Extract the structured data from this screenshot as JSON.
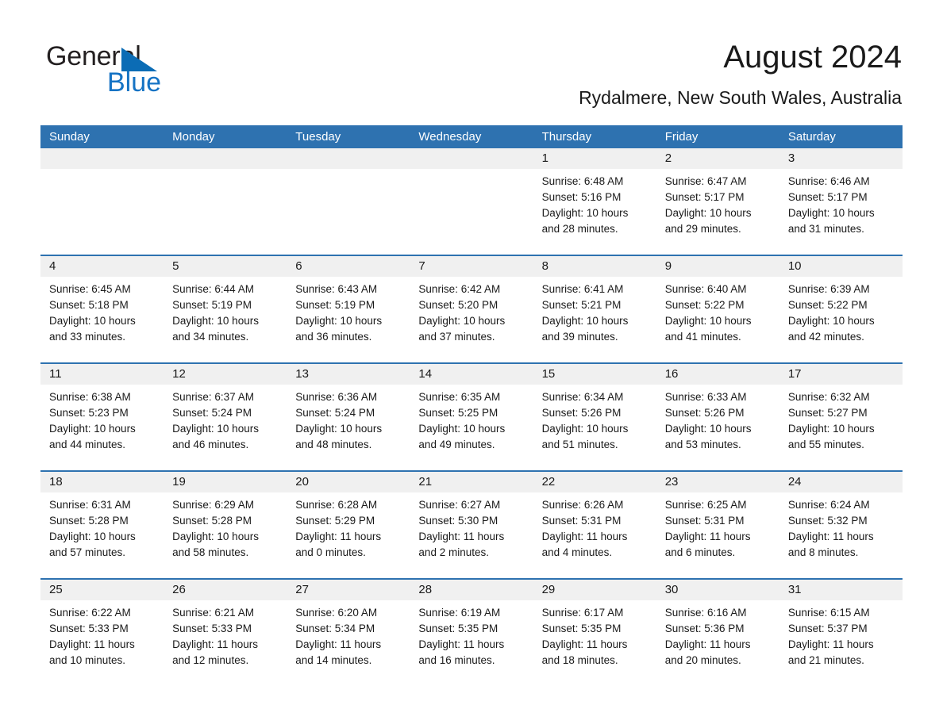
{
  "logo": {
    "word_one": "General",
    "word_two": "Blue",
    "triangle_color": "#0b6cb5",
    "blue_text_color": "#1573c4"
  },
  "header": {
    "title": "August 2024",
    "location": "Rydalmere, New South Wales, Australia"
  },
  "theme": {
    "header_blue": "#2e72b0",
    "date_band_gray": "#f0f0f0",
    "text_color": "#1a1a1a"
  },
  "calendar": {
    "weekday_headers": [
      "Sunday",
      "Monday",
      "Tuesday",
      "Wednesday",
      "Thursday",
      "Friday",
      "Saturday"
    ],
    "weeks": [
      {
        "days": [
          {
            "date": "",
            "lines": []
          },
          {
            "date": "",
            "lines": []
          },
          {
            "date": "",
            "lines": []
          },
          {
            "date": "",
            "lines": []
          },
          {
            "date": "1",
            "lines": [
              "Sunrise: 6:48 AM",
              "Sunset: 5:16 PM",
              "Daylight: 10 hours",
              "and 28 minutes."
            ]
          },
          {
            "date": "2",
            "lines": [
              "Sunrise: 6:47 AM",
              "Sunset: 5:17 PM",
              "Daylight: 10 hours",
              "and 29 minutes."
            ]
          },
          {
            "date": "3",
            "lines": [
              "Sunrise: 6:46 AM",
              "Sunset: 5:17 PM",
              "Daylight: 10 hours",
              "and 31 minutes."
            ]
          }
        ]
      },
      {
        "days": [
          {
            "date": "4",
            "lines": [
              "Sunrise: 6:45 AM",
              "Sunset: 5:18 PM",
              "Daylight: 10 hours",
              "and 33 minutes."
            ]
          },
          {
            "date": "5",
            "lines": [
              "Sunrise: 6:44 AM",
              "Sunset: 5:19 PM",
              "Daylight: 10 hours",
              "and 34 minutes."
            ]
          },
          {
            "date": "6",
            "lines": [
              "Sunrise: 6:43 AM",
              "Sunset: 5:19 PM",
              "Daylight: 10 hours",
              "and 36 minutes."
            ]
          },
          {
            "date": "7",
            "lines": [
              "Sunrise: 6:42 AM",
              "Sunset: 5:20 PM",
              "Daylight: 10 hours",
              "and 37 minutes."
            ]
          },
          {
            "date": "8",
            "lines": [
              "Sunrise: 6:41 AM",
              "Sunset: 5:21 PM",
              "Daylight: 10 hours",
              "and 39 minutes."
            ]
          },
          {
            "date": "9",
            "lines": [
              "Sunrise: 6:40 AM",
              "Sunset: 5:22 PM",
              "Daylight: 10 hours",
              "and 41 minutes."
            ]
          },
          {
            "date": "10",
            "lines": [
              "Sunrise: 6:39 AM",
              "Sunset: 5:22 PM",
              "Daylight: 10 hours",
              "and 42 minutes."
            ]
          }
        ]
      },
      {
        "days": [
          {
            "date": "11",
            "lines": [
              "Sunrise: 6:38 AM",
              "Sunset: 5:23 PM",
              "Daylight: 10 hours",
              "and 44 minutes."
            ]
          },
          {
            "date": "12",
            "lines": [
              "Sunrise: 6:37 AM",
              "Sunset: 5:24 PM",
              "Daylight: 10 hours",
              "and 46 minutes."
            ]
          },
          {
            "date": "13",
            "lines": [
              "Sunrise: 6:36 AM",
              "Sunset: 5:24 PM",
              "Daylight: 10 hours",
              "and 48 minutes."
            ]
          },
          {
            "date": "14",
            "lines": [
              "Sunrise: 6:35 AM",
              "Sunset: 5:25 PM",
              "Daylight: 10 hours",
              "and 49 minutes."
            ]
          },
          {
            "date": "15",
            "lines": [
              "Sunrise: 6:34 AM",
              "Sunset: 5:26 PM",
              "Daylight: 10 hours",
              "and 51 minutes."
            ]
          },
          {
            "date": "16",
            "lines": [
              "Sunrise: 6:33 AM",
              "Sunset: 5:26 PM",
              "Daylight: 10 hours",
              "and 53 minutes."
            ]
          },
          {
            "date": "17",
            "lines": [
              "Sunrise: 6:32 AM",
              "Sunset: 5:27 PM",
              "Daylight: 10 hours",
              "and 55 minutes."
            ]
          }
        ]
      },
      {
        "days": [
          {
            "date": "18",
            "lines": [
              "Sunrise: 6:31 AM",
              "Sunset: 5:28 PM",
              "Daylight: 10 hours",
              "and 57 minutes."
            ]
          },
          {
            "date": "19",
            "lines": [
              "Sunrise: 6:29 AM",
              "Sunset: 5:28 PM",
              "Daylight: 10 hours",
              "and 58 minutes."
            ]
          },
          {
            "date": "20",
            "lines": [
              "Sunrise: 6:28 AM",
              "Sunset: 5:29 PM",
              "Daylight: 11 hours",
              "and 0 minutes."
            ]
          },
          {
            "date": "21",
            "lines": [
              "Sunrise: 6:27 AM",
              "Sunset: 5:30 PM",
              "Daylight: 11 hours",
              "and 2 minutes."
            ]
          },
          {
            "date": "22",
            "lines": [
              "Sunrise: 6:26 AM",
              "Sunset: 5:31 PM",
              "Daylight: 11 hours",
              "and 4 minutes."
            ]
          },
          {
            "date": "23",
            "lines": [
              "Sunrise: 6:25 AM",
              "Sunset: 5:31 PM",
              "Daylight: 11 hours",
              "and 6 minutes."
            ]
          },
          {
            "date": "24",
            "lines": [
              "Sunrise: 6:24 AM",
              "Sunset: 5:32 PM",
              "Daylight: 11 hours",
              "and 8 minutes."
            ]
          }
        ]
      },
      {
        "days": [
          {
            "date": "25",
            "lines": [
              "Sunrise: 6:22 AM",
              "Sunset: 5:33 PM",
              "Daylight: 11 hours",
              "and 10 minutes."
            ]
          },
          {
            "date": "26",
            "lines": [
              "Sunrise: 6:21 AM",
              "Sunset: 5:33 PM",
              "Daylight: 11 hours",
              "and 12 minutes."
            ]
          },
          {
            "date": "27",
            "lines": [
              "Sunrise: 6:20 AM",
              "Sunset: 5:34 PM",
              "Daylight: 11 hours",
              "and 14 minutes."
            ]
          },
          {
            "date": "28",
            "lines": [
              "Sunrise: 6:19 AM",
              "Sunset: 5:35 PM",
              "Daylight: 11 hours",
              "and 16 minutes."
            ]
          },
          {
            "date": "29",
            "lines": [
              "Sunrise: 6:17 AM",
              "Sunset: 5:35 PM",
              "Daylight: 11 hours",
              "and 18 minutes."
            ]
          },
          {
            "date": "30",
            "lines": [
              "Sunrise: 6:16 AM",
              "Sunset: 5:36 PM",
              "Daylight: 11 hours",
              "and 20 minutes."
            ]
          },
          {
            "date": "31",
            "lines": [
              "Sunrise: 6:15 AM",
              "Sunset: 5:37 PM",
              "Daylight: 11 hours",
              "and 21 minutes."
            ]
          }
        ]
      }
    ]
  }
}
